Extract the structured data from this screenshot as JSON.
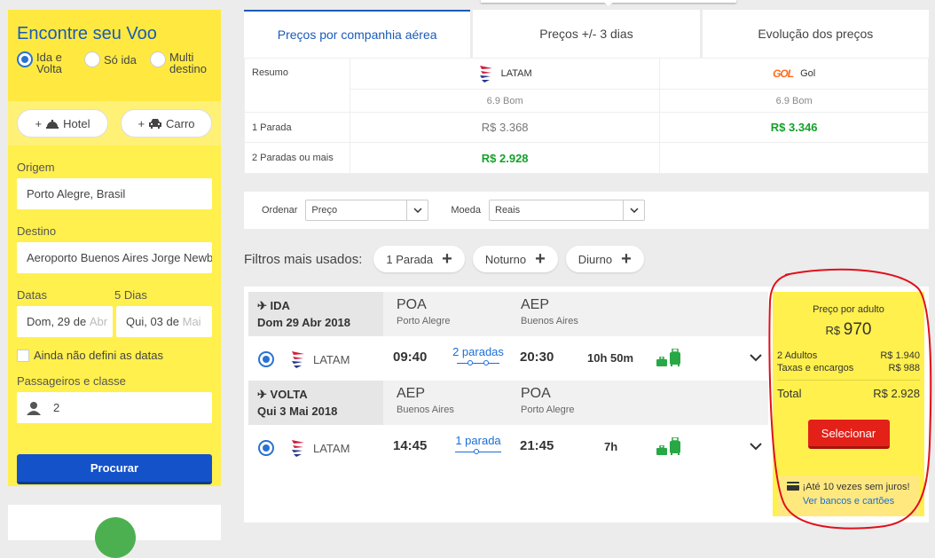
{
  "sidebar": {
    "title": "Encontre seu Voo",
    "trip_types": [
      {
        "label": "Ida e Volta",
        "checked": true
      },
      {
        "label": "Só ida",
        "checked": false
      },
      {
        "label": "Multi destino",
        "checked": false
      }
    ],
    "hotel_label": "Hotel",
    "car_label": "Carro",
    "origin_label": "Origem",
    "origin_value": "Porto Alegre, Brasil",
    "dest_label": "Destino",
    "dest_value": "Aeroporto Buenos Aires Jorge Newbery",
    "dates_label": "Datas",
    "days_label": "5 Dias",
    "date_from_day": "Dom, 29 de ",
    "date_from_fade": "Abr",
    "date_to_day": "Qui, 03 de ",
    "date_to_fade": "Mai",
    "undefined_dates_label": "Ainda não defini as datas",
    "passengers_label": "Passageiros e classe",
    "passengers_value": "2",
    "search_button": "Procurar"
  },
  "tabs": [
    {
      "label": "Preços por companhia aérea",
      "active": true
    },
    {
      "label": "Preços +/- 3 dias",
      "active": false
    },
    {
      "label": "Evolução dos preços",
      "active": false
    }
  ],
  "summary": {
    "row_resumo": "Resumo",
    "airline_latam": "LATAM",
    "airline_gol": "Gol",
    "gol_logo_text": "GOL",
    "latam_score": "6.9 Bom",
    "gol_score": "6.9 Bom",
    "row_1stop": "1 Parada",
    "latam_1stop": "R$ 3.368",
    "gol_1stop": "R$ 3.346",
    "row_2stops": "2 Paradas ou mais",
    "latam_2stops": "R$ 2.928",
    "gol_2stops": ""
  },
  "sort": {
    "order_label": "Ordenar",
    "order_value": "Preço",
    "currency_label": "Moeda",
    "currency_value": "Reais"
  },
  "filters": {
    "label": "Filtros mais usados:",
    "items": [
      "1 Parada",
      "Noturno",
      "Diurno"
    ]
  },
  "itinerary": {
    "outbound": {
      "tag": "IDA",
      "date": "Dom 29 Abr 2018",
      "from_code": "POA",
      "from_city": "Porto Alegre",
      "to_code": "AEP",
      "to_city": "Buenos Aires",
      "airline": "LATAM",
      "depart": "09:40",
      "stops": "2 paradas",
      "arrive": "20:30",
      "duration": "10h 50m"
    },
    "inbound": {
      "tag": "VOLTA",
      "date": "Qui 3 Mai 2018",
      "from_code": "AEP",
      "from_city": "Buenos Aires",
      "to_code": "POA",
      "to_city": "Porto Alegre",
      "airline": "LATAM",
      "depart": "14:45",
      "stops": "1 parada",
      "arrive": "21:45",
      "duration": "7h"
    }
  },
  "price": {
    "title": "Preço por adulto",
    "currency": "R$",
    "amount": "970",
    "adults_label": "2 Adultos",
    "adults_value": "R$ 1.940",
    "taxes_label": "Taxas e encargos",
    "taxes_value": "R$ 988",
    "total_label": "Total",
    "total_value": "R$ 2.928",
    "select_button": "Selecionar",
    "installments": "¡Até 10 vezes sem juros!",
    "banks_link": "Ver bancos e cartões"
  },
  "colors": {
    "brand_blue": "#1a5bb8",
    "sidebar_yellow": "#fff04d",
    "price_green": "#16a02c",
    "select_red": "#e32119",
    "annotation_red": "#e0101a"
  }
}
